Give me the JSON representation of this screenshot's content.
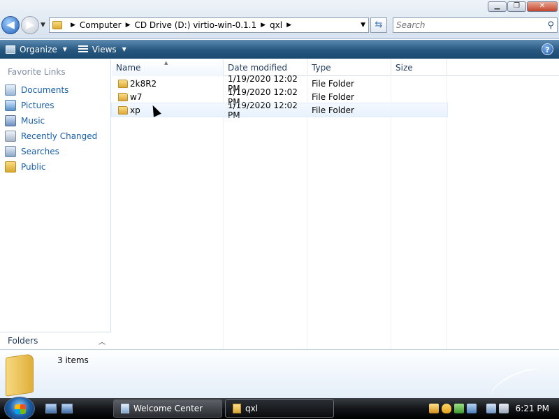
{
  "addressbar": {
    "crumbs": [
      "Computer",
      "CD Drive (D:) virtio-win-0.1.1",
      "qxl"
    ],
    "search_placeholder": "Search"
  },
  "toolbar": {
    "organize_label": "Organize",
    "views_label": "Views"
  },
  "navpane": {
    "header": "Favorite Links",
    "items": [
      {
        "label": "Documents",
        "icon": "documents-icon"
      },
      {
        "label": "Pictures",
        "icon": "pictures-icon"
      },
      {
        "label": "Music",
        "icon": "music-icon"
      },
      {
        "label": "Recently Changed",
        "icon": "recently-changed-icon"
      },
      {
        "label": "Searches",
        "icon": "searches-icon"
      },
      {
        "label": "Public",
        "icon": "public-folder-icon"
      }
    ],
    "folders_label": "Folders"
  },
  "filelist": {
    "columns": {
      "name": "Name",
      "date": "Date modified",
      "type": "Type",
      "size": "Size"
    },
    "rows": [
      {
        "name": "2k8R2",
        "date": "1/19/2020 12:02 PM",
        "type": "File Folder",
        "size": ""
      },
      {
        "name": "w7",
        "date": "1/19/2020 12:02 PM",
        "type": "File Folder",
        "size": ""
      },
      {
        "name": "xp",
        "date": "1/19/2020 12:02 PM",
        "type": "File Folder",
        "size": ""
      }
    ]
  },
  "details": {
    "item_count": "3 items"
  },
  "taskbar": {
    "tasks": [
      {
        "label": "Welcome Center"
      },
      {
        "label": "qxl"
      }
    ],
    "clock": "6:21 PM"
  },
  "colors": {
    "toolbar": "#27577f",
    "link": "#1a5fab",
    "folder": "#dba737"
  }
}
